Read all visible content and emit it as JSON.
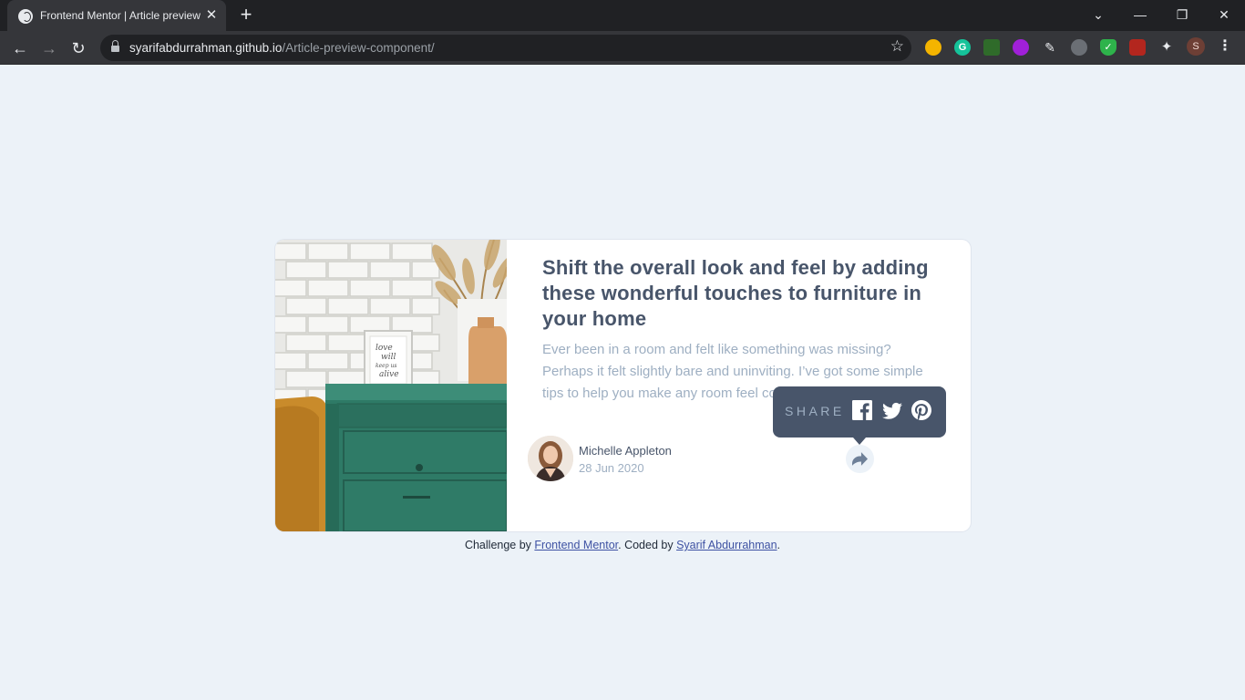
{
  "browser": {
    "tab_title": "Frontend Mentor | Article preview component",
    "url_host": "syarifabdurrahman.github.io",
    "url_path": "/Article-preview-component/",
    "profile_initial": "S",
    "extensions": [
      "chrome-extension-icon",
      "grammarly-icon",
      "tree-extension-icon",
      "purple-extension-icon",
      "pen-extension-icon",
      "shield-extension-icon",
      "green-shield-extension-icon",
      "red-extension-icon",
      "puzzle-extensions-icon"
    ]
  },
  "article": {
    "title": "Shift the overall look and feel by adding these wonderful touches to furniture in your home",
    "description": "Ever been in a room and felt like something was missing? Perhaps it felt slightly bare and uninviting. I’ve got some simple tips to help you make any room feel complete.",
    "author_name": "Michelle Appleton",
    "date": "28 Jun 2020"
  },
  "share": {
    "label": "SHARE",
    "networks": [
      "facebook-icon",
      "twitter-icon",
      "pinterest-icon"
    ]
  },
  "attribution": {
    "prefix": "Challenge by ",
    "link1": "Frontend Mentor",
    "middle": ". Coded by ",
    "link2": "Syarif Abdurrahman",
    "suffix": "."
  },
  "colors": {
    "page_bg": "#ecf2f8",
    "title": "#48556a",
    "muted": "#9eafc2",
    "popup_bg": "#48556a"
  }
}
